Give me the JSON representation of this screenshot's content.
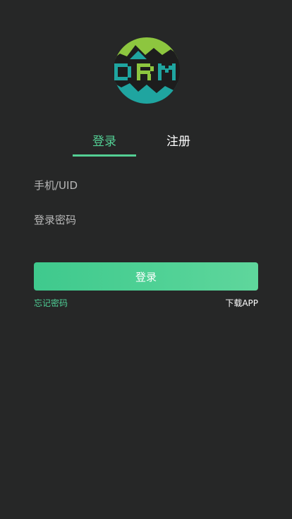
{
  "logo": {
    "text": "DRM",
    "colors": {
      "green": "#8dc63f",
      "teal": "#1fa5a0",
      "dark": "#1d1d1d"
    }
  },
  "tabs": [
    {
      "label": "登录",
      "active": true
    },
    {
      "label": "注册",
      "active": false
    }
  ],
  "form": {
    "phone_placeholder": "手机/UID",
    "password_placeholder": "登录密码",
    "submit_label": "登录"
  },
  "links": {
    "forgot_password": "忘记密码",
    "download_app": "下载APP"
  },
  "colors": {
    "background": "#262727",
    "accent": "#53cf94"
  }
}
